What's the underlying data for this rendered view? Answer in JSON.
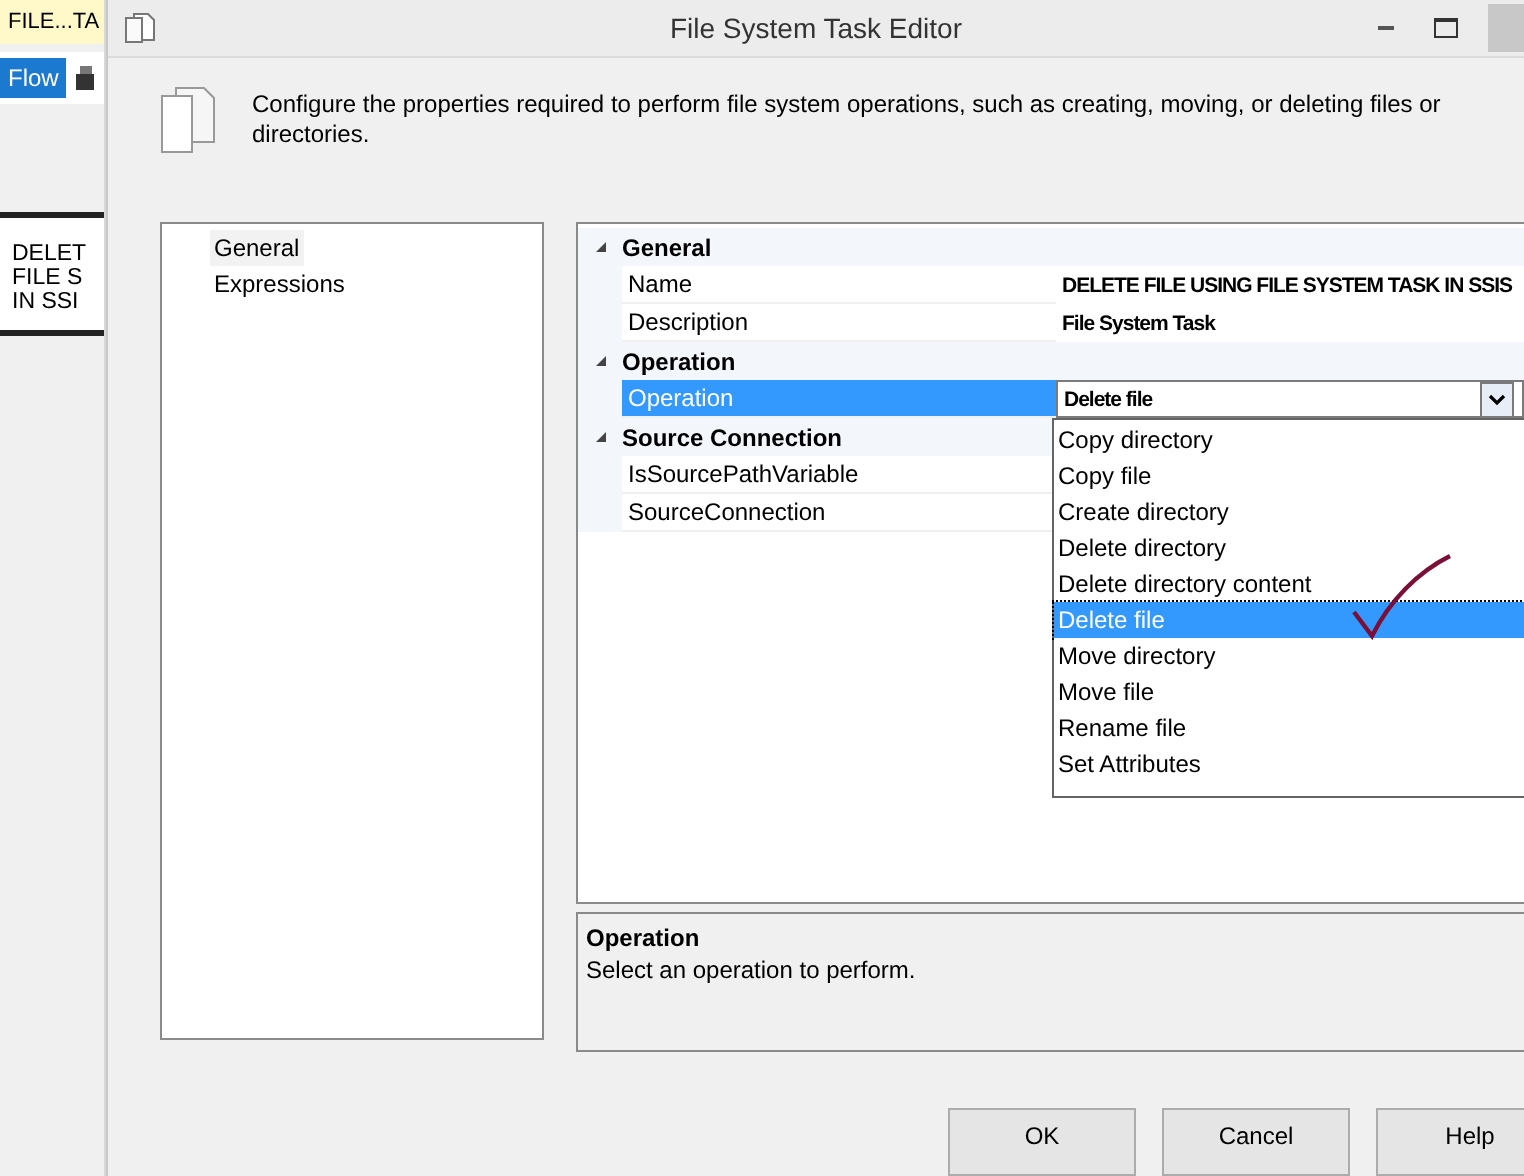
{
  "background_app": {
    "tab": "FILE...TA",
    "flow_tab": "Flow",
    "task_lines": [
      "DELET",
      "FILE S",
      "IN SSI"
    ]
  },
  "window": {
    "title": "File System Task Editor"
  },
  "header": {
    "description": "Configure the properties required to perform file system operations, such as creating, moving, or deleting files or directories."
  },
  "sidebar": {
    "items": [
      {
        "label": "General",
        "selected": true
      },
      {
        "label": "Expressions",
        "selected": false
      }
    ]
  },
  "properties": [
    {
      "category": "General",
      "expanded": true,
      "rows": [
        {
          "name": "Name",
          "value": "DELETE FILE USING FILE SYSTEM TASK IN SSIS",
          "selected": false
        },
        {
          "name": "Description",
          "value": "File System Task",
          "selected": false
        }
      ]
    },
    {
      "category": "Operation",
      "expanded": true,
      "rows": [
        {
          "name": "Operation",
          "value": "Delete file",
          "selected": true,
          "kind": "dropdown"
        }
      ]
    },
    {
      "category": "Source Connection",
      "expanded": true,
      "rows": [
        {
          "name": "IsSourcePathVariable",
          "value": "",
          "selected": false
        },
        {
          "name": "SourceConnection",
          "value": "",
          "selected": false
        }
      ]
    }
  ],
  "dropdown": {
    "options": [
      {
        "label": "Copy directory",
        "selected": false
      },
      {
        "label": "Copy file",
        "selected": false
      },
      {
        "label": "Create directory",
        "selected": false
      },
      {
        "label": "Delete directory",
        "selected": false
      },
      {
        "label": "Delete directory content",
        "selected": false
      },
      {
        "label": "Delete file",
        "selected": true
      },
      {
        "label": "Move directory",
        "selected": false
      },
      {
        "label": "Move file",
        "selected": false
      },
      {
        "label": "Rename file",
        "selected": false
      },
      {
        "label": "Set Attributes",
        "selected": false
      }
    ]
  },
  "help": {
    "title": "Operation",
    "text": "Select an operation to perform."
  },
  "buttons": [
    "OK",
    "Cancel",
    "Help"
  ]
}
